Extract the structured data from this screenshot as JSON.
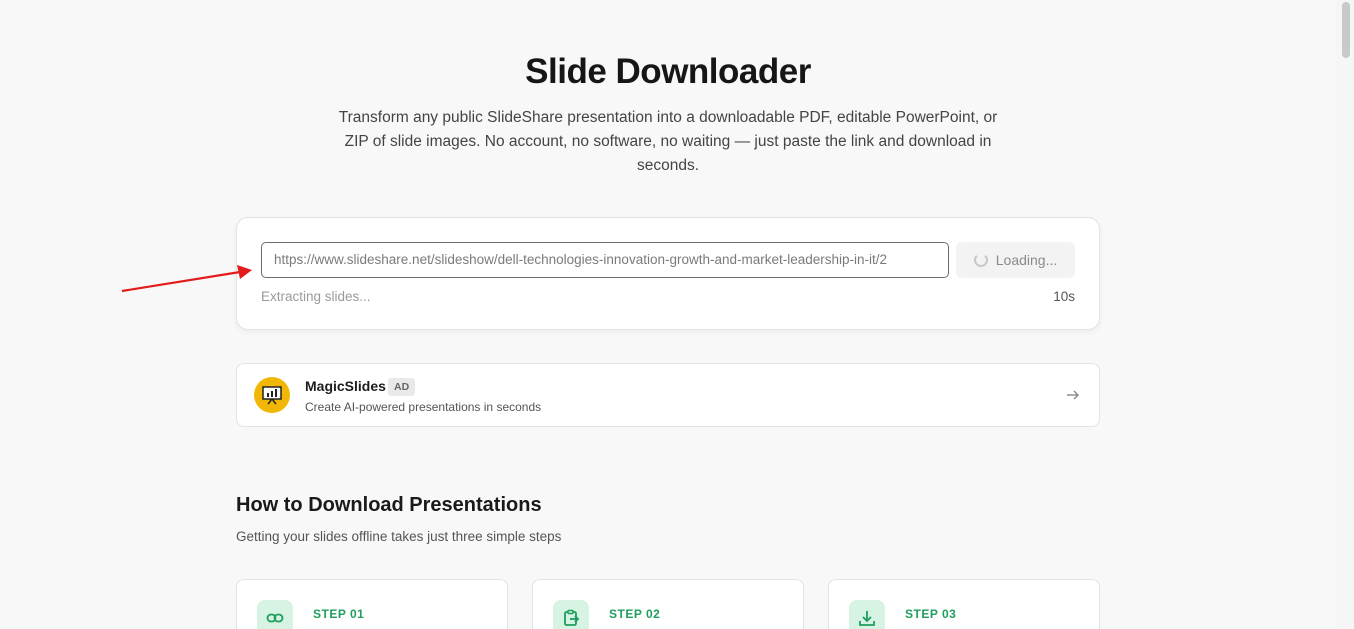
{
  "header": {
    "title": "Slide Downloader",
    "subtitle": "Transform any public SlideShare presentation into a downloadable PDF, editable PowerPoint, or ZIP of slide images. No account, no software, no waiting — just paste the link and download in seconds."
  },
  "downloader": {
    "url_value": "https://www.slideshare.net/slideshow/dell-technologies-innovation-growth-and-market-leadership-in-it/2",
    "button_label": "Loading...",
    "status": "Extracting slides...",
    "timer": "10s"
  },
  "ad": {
    "name": "MagicSlides",
    "badge": "AD",
    "description": "Create AI-powered presentations in seconds"
  },
  "how_to": {
    "title": "How to Download Presentations",
    "subtitle": "Getting your slides offline takes just three simple steps",
    "steps": [
      {
        "label": "STEP 01",
        "icon": "link-icon"
      },
      {
        "label": "STEP 02",
        "icon": "clipboard-paste-icon"
      },
      {
        "label": "STEP 03",
        "icon": "download-icon"
      }
    ]
  },
  "colors": {
    "accent_green": "#1e9d5c",
    "ad_logo_yellow": "#f2b705",
    "annotation_red": "#e31b1b"
  }
}
